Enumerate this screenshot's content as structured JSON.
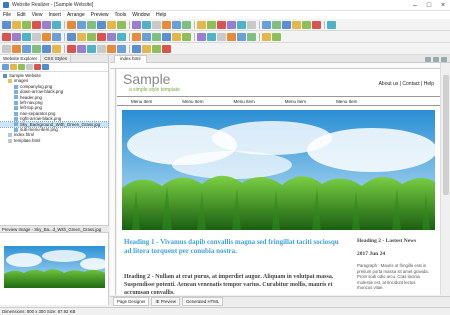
{
  "window": {
    "title": "Website Realizer - [Sample Website]"
  },
  "menu": [
    "File",
    "Edit",
    "View",
    "Insert",
    "Arrange",
    "Preview",
    "Tools",
    "Window",
    "Help"
  ],
  "explorer": {
    "tabs": [
      "Website Explorer",
      "CSS Styles"
    ],
    "tree": {
      "root": "Sample Website",
      "folder": "images",
      "files": [
        "companylog.png",
        "down-arrow-black.png",
        "header.png",
        "left-nav.png",
        "left-top.png",
        "nav-separator.png",
        "right-arrow-black.png",
        "Sky_Background_With_Green_Grass.jpg",
        "sub-menu-item.png"
      ],
      "pages": [
        "index.html",
        "template.html"
      ]
    }
  },
  "preview": {
    "label": "Preview Image - Sky_Ba...d_With_Green_Grass.jpg"
  },
  "status": {
    "text": "Dimensions: 800 x 300 Size: 87.92 KB"
  },
  "document": {
    "tab": "index.html"
  },
  "bottom_tabs": [
    "Page Designer",
    "IE Preview",
    "Generated HTML"
  ],
  "site": {
    "title": "Sample",
    "subtitle": "a simple style template",
    "links": "About us | Contact | Help",
    "nav": [
      "Menu Item",
      "Menu Item",
      "Menu Item",
      "Menu Item",
      "Menu Item"
    ],
    "heading1": "Heading 1 - Vivamus dapib convallis magna sed fringillat taciti sociosqu ad litora torquent per conubia nostra.",
    "heading2": "Heading 2 - Nullam at erat purus, at imperdiet augue. Aliquam in volutpat massa. Suspendisse potenti. Aenean venenatis tempor varius. Curabitur mollis, mauris et accumsan convallis.",
    "right_heading": "Heading 2 - Lastest News",
    "right_date": "2017 Jun 24",
    "right_para": "Paragraph : Mauris ut fringilla erat in pretium porta massa sit amet gravida. Proin sodi odio arcu. Cras lacinia molestie est, at tincidunt lectus rhoncus vitae."
  },
  "colors": {
    "accent": "#3fa0d8",
    "subtitle": "#79a83f",
    "selection": "#cde3f8"
  }
}
